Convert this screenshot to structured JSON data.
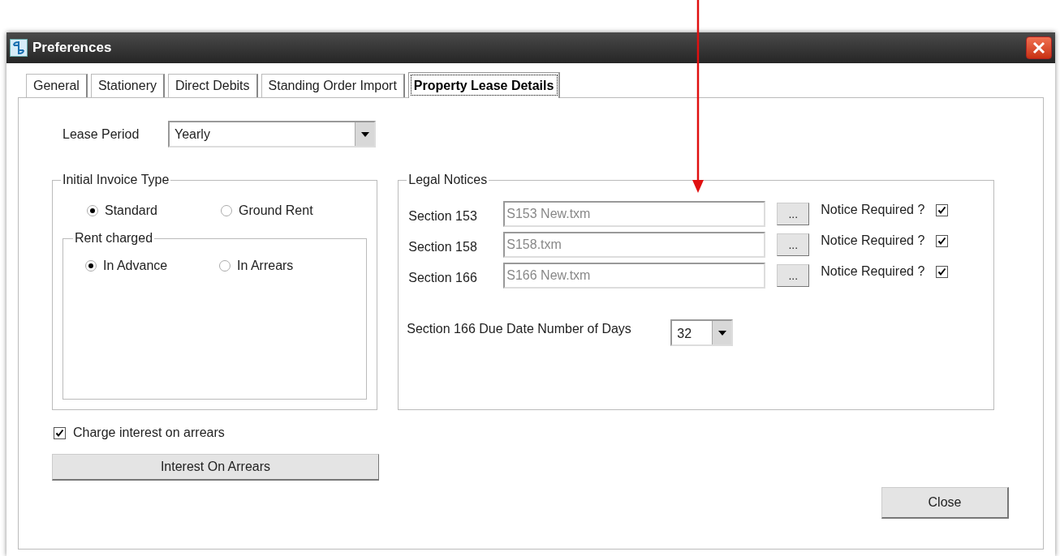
{
  "window": {
    "title": "Preferences"
  },
  "tabs": [
    {
      "label": "General",
      "selected": false
    },
    {
      "label": "Stationery",
      "selected": false
    },
    {
      "label": "Direct Debits",
      "selected": false
    },
    {
      "label": "Standing Order Import",
      "selected": false
    },
    {
      "label": "Property Lease Details",
      "selected": true
    }
  ],
  "lease_period": {
    "label": "Lease Period",
    "value": "Yearly"
  },
  "initial_invoice_type": {
    "title": "Initial Invoice Type",
    "options": [
      {
        "label": "Standard",
        "selected": true
      },
      {
        "label": "Ground Rent",
        "selected": false
      }
    ]
  },
  "rent_charged": {
    "title": "Rent charged",
    "options": [
      {
        "label": "In Advance",
        "selected": true
      },
      {
        "label": "In Arrears",
        "selected": false
      }
    ]
  },
  "legal_notices": {
    "title": "Legal Notices",
    "rows": [
      {
        "label": "Section 153",
        "file": "S153 New.txm",
        "browse": "...",
        "notice_label": "Notice Required ?",
        "checked": true
      },
      {
        "label": "Section 158",
        "file": "S158.txm",
        "browse": "...",
        "notice_label": "Notice Required ?",
        "checked": true
      },
      {
        "label": "Section 166",
        "file": "S166 New.txm",
        "browse": "...",
        "notice_label": "Notice Required ?",
        "checked": true
      }
    ],
    "due_days": {
      "label": "Section 166 Due Date Number of Days",
      "value": "32"
    }
  },
  "charge_interest": {
    "label": "Charge interest on arrears",
    "checked": true
  },
  "interest_button": "Interest On Arrears",
  "close_button": "Close"
}
